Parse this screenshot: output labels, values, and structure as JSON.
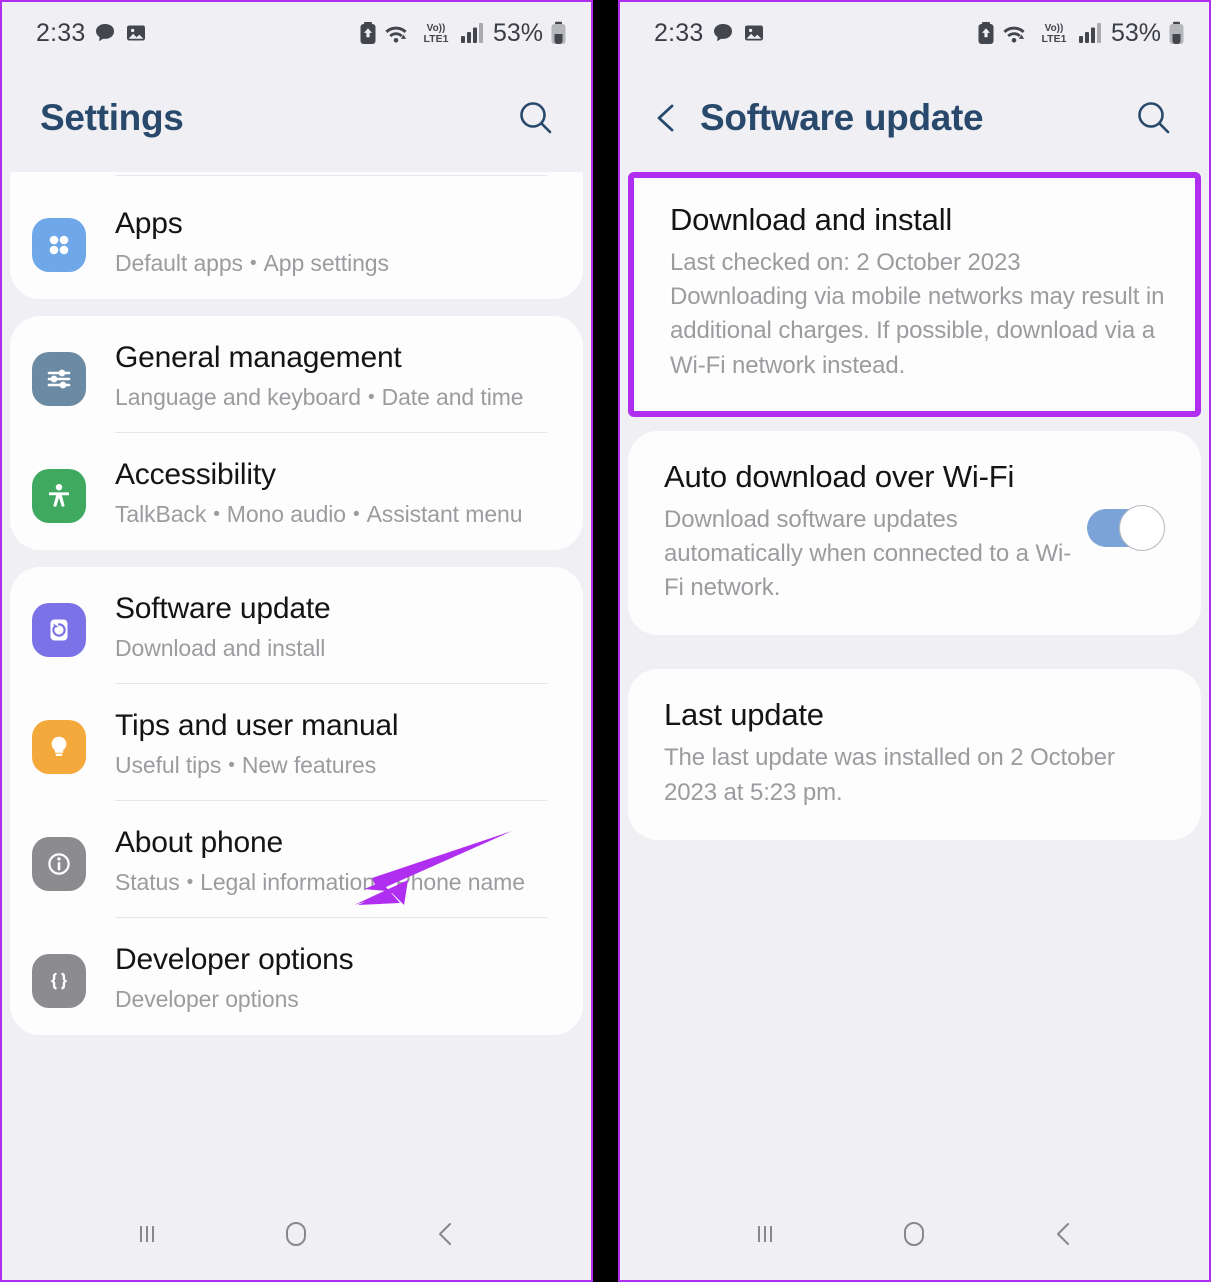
{
  "accent": {
    "annotation_purple": "#b02ef0",
    "header_blue": "#28496b",
    "toggle_on": "#7ca3d8",
    "screen_bg": "#f0f0f4",
    "card_bg": "#fdfdfd"
  },
  "status_bar": {
    "time": "2:33",
    "battery_percent": "53%",
    "network_label": "VoLTE1",
    "icons": [
      "chat-bubble-icon",
      "image-icon",
      "battery-saver-icon",
      "wifi-icon",
      "volte-icon",
      "signal-bars-icon",
      "battery-icon"
    ]
  },
  "left_screen": {
    "header": {
      "title": "Settings",
      "search_icon": "search-icon"
    },
    "groups": [
      {
        "clipped_top": true,
        "items": [
          {
            "title": "Apps",
            "subtitle_parts": [
              "Default apps",
              "App settings"
            ],
            "icon": "apps-grid-icon",
            "icon_color": "#6fa8e8",
            "divider": false
          }
        ]
      },
      {
        "clipped_top": false,
        "items": [
          {
            "title": "General management",
            "subtitle_parts": [
              "Language and keyboard",
              "Date and time"
            ],
            "icon": "sliders-icon",
            "icon_color": "#6b8ba4",
            "divider": true
          },
          {
            "title": "Accessibility",
            "subtitle_parts": [
              "TalkBack",
              "Mono audio",
              "Assistant menu"
            ],
            "icon": "accessibility-person-icon",
            "icon_color": "#3fa95f",
            "divider": false
          }
        ]
      },
      {
        "clipped_top": false,
        "items": [
          {
            "title": "Software update",
            "subtitle_parts": [
              "Download and install"
            ],
            "icon": "software-update-icon",
            "icon_color": "#7b72e8",
            "divider": true
          },
          {
            "title": "Tips and user manual",
            "subtitle_parts": [
              "Useful tips",
              "New features"
            ],
            "icon": "lightbulb-icon",
            "icon_color": "#f4a93c",
            "divider": true
          },
          {
            "title": "About phone",
            "subtitle_parts": [
              "Status",
              "Legal information",
              "Phone name"
            ],
            "icon": "info-icon",
            "icon_color": "#8b8b90",
            "divider": true
          },
          {
            "title": "Developer options",
            "subtitle_parts": [
              "Developer options"
            ],
            "icon": "code-braces-icon",
            "icon_color": "#8b8b90",
            "divider": false
          }
        ]
      }
    ]
  },
  "right_screen": {
    "header": {
      "back_icon": "chevron-left-icon",
      "title": "Software update",
      "search_icon": "search-icon"
    },
    "download_and_install": {
      "title": "Download and install",
      "last_checked": "Last checked on: 2 October 2023",
      "description": "Downloading via mobile networks may result in additional charges. If possible, download via a Wi-Fi network instead.",
      "highlighted": true
    },
    "auto_download": {
      "title": "Auto download over Wi-Fi",
      "description": "Download software updates automatically when connected to a Wi-Fi network.",
      "toggle_state": "on"
    },
    "last_update": {
      "title": "Last update",
      "description": "The last update was installed on 2 October 2023 at 5:23 pm."
    }
  },
  "nav_bar": {
    "recents_icon": "recents-icon",
    "home_icon": "home-icon",
    "back_icon": "back-icon"
  },
  "annotation": {
    "arrow_target": "Software update",
    "arrow_color": "#b02ef0"
  }
}
